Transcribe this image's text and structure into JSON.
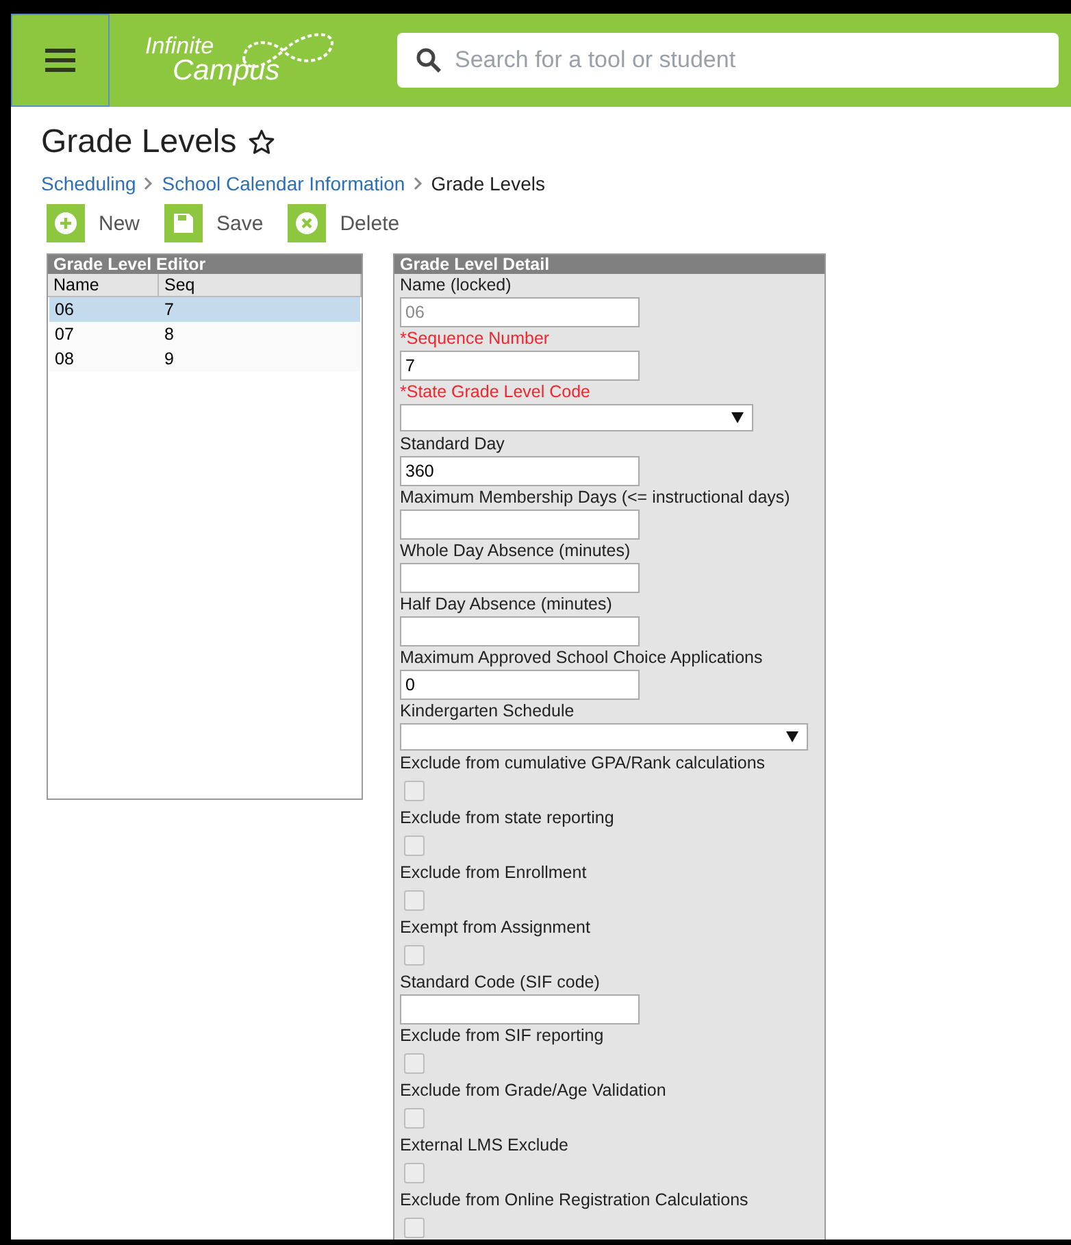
{
  "header": {
    "search": {
      "placeholder": "Search for a tool or student"
    },
    "logo": {
      "line1": "Infinite",
      "line2": "Campus"
    }
  },
  "page": {
    "title": "Grade Levels",
    "favorite": false,
    "breadcrumb": [
      {
        "label": "Scheduling",
        "link": true
      },
      {
        "label": "School Calendar Information",
        "link": true
      },
      {
        "label": "Grade Levels",
        "link": false
      }
    ]
  },
  "toolbar": [
    {
      "kind": "new",
      "label": "New"
    },
    {
      "kind": "save",
      "label": "Save"
    },
    {
      "kind": "delete",
      "label": "Delete"
    }
  ],
  "editor": {
    "title": "Grade Level Editor",
    "columns": [
      "Name",
      "Seq"
    ],
    "rows": [
      {
        "cells": [
          "06",
          "7"
        ],
        "selected": true
      },
      {
        "cells": [
          "07",
          "8"
        ],
        "selected": false
      },
      {
        "cells": [
          "08",
          "9"
        ],
        "selected": false
      }
    ]
  },
  "detail": {
    "title": "Grade Level Detail",
    "fields": [
      {
        "kind": "text",
        "label": "Name (locked)",
        "value": "06",
        "disabled": true,
        "required": false
      },
      {
        "kind": "text",
        "label": "*Sequence Number",
        "value": "7",
        "disabled": false,
        "required": true
      },
      {
        "kind": "select",
        "label": "*State Grade Level Code",
        "required": true,
        "wide": false
      },
      {
        "kind": "text",
        "label": "Standard Day",
        "value": "360",
        "disabled": false,
        "required": false
      },
      {
        "kind": "text",
        "label": "Maximum Membership Days (<= instructional days)",
        "required": false
      },
      {
        "kind": "text",
        "label": "Whole Day Absence (minutes)",
        "required": false
      },
      {
        "kind": "text",
        "label": "Half Day Absence (minutes)",
        "required": false
      },
      {
        "kind": "text",
        "label": "Maximum Approved School Choice Applications",
        "value": "0",
        "disabled": false,
        "required": false
      },
      {
        "kind": "select",
        "label": "Kindergarten Schedule",
        "required": false,
        "wide": true
      },
      {
        "kind": "checkbox",
        "label": "Exclude from cumulative GPA/Rank calculations",
        "checked": false
      },
      {
        "kind": "checkbox",
        "label": "Exclude from state reporting",
        "checked": false
      },
      {
        "kind": "checkbox",
        "label": "Exclude from Enrollment",
        "checked": false
      },
      {
        "kind": "checkbox",
        "label": "Exempt from Assignment",
        "checked": false
      },
      {
        "kind": "text",
        "label": "Standard Code (SIF code)",
        "required": false
      },
      {
        "kind": "checkbox",
        "label": "Exclude from SIF reporting",
        "checked": false
      },
      {
        "kind": "checkbox",
        "label": "Exclude from Grade/Age Validation",
        "checked": false
      },
      {
        "kind": "checkbox",
        "label": "External LMS Exclude",
        "checked": false
      },
      {
        "kind": "checkbox",
        "label": "Exclude from Online Registration Calculations",
        "checked": false
      }
    ]
  }
}
